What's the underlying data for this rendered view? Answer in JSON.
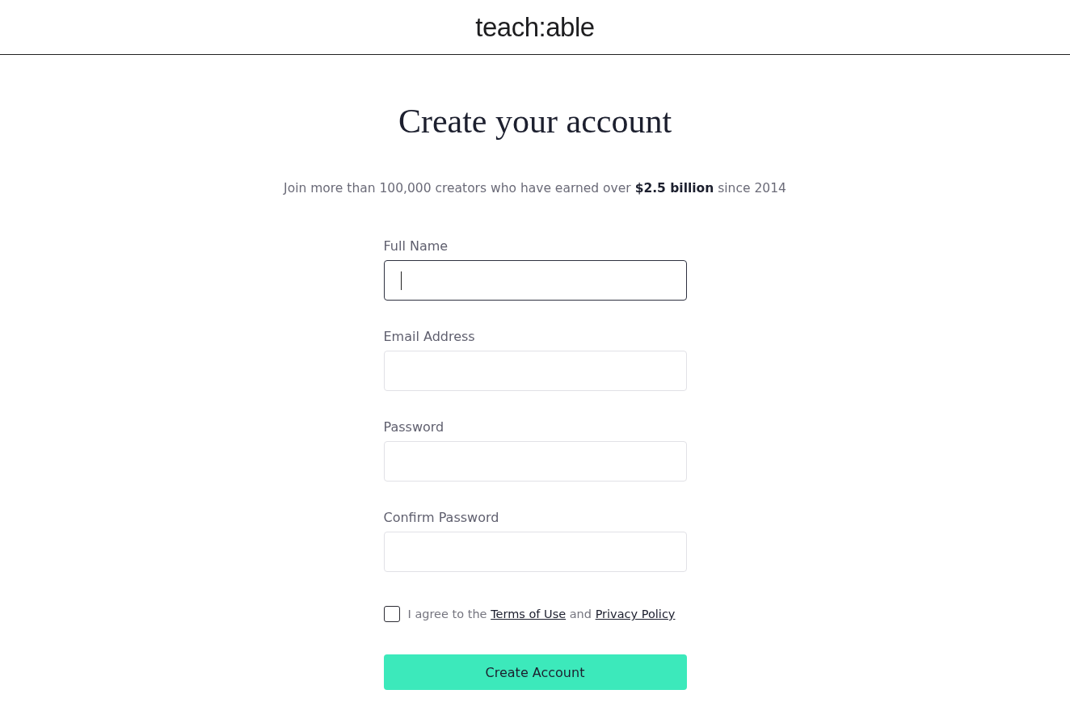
{
  "header": {
    "logo": "teach:able"
  },
  "title": "Create your account",
  "subtitle": "Join more than 100,000 creators who have earned over **$2.5 billion** since 2014",
  "fields": [
    {
      "label": "Full Name",
      "focused": true
    },
    {
      "label": "Email Address",
      "focused": false
    },
    {
      "label": "Password",
      "focused": false
    },
    {
      "label": "Confirm Password",
      "focused": false
    }
  ],
  "agreement": {
    "checked": false,
    "parts": [
      {
        "kind": "text",
        "text": "I agree to the"
      },
      {
        "kind": "link",
        "text": "Terms of Use"
      },
      {
        "kind": "text",
        "text": "and"
      },
      {
        "kind": "link",
        "text": "Privacy Policy"
      }
    ]
  },
  "submit": {
    "label": "Create Account"
  }
}
